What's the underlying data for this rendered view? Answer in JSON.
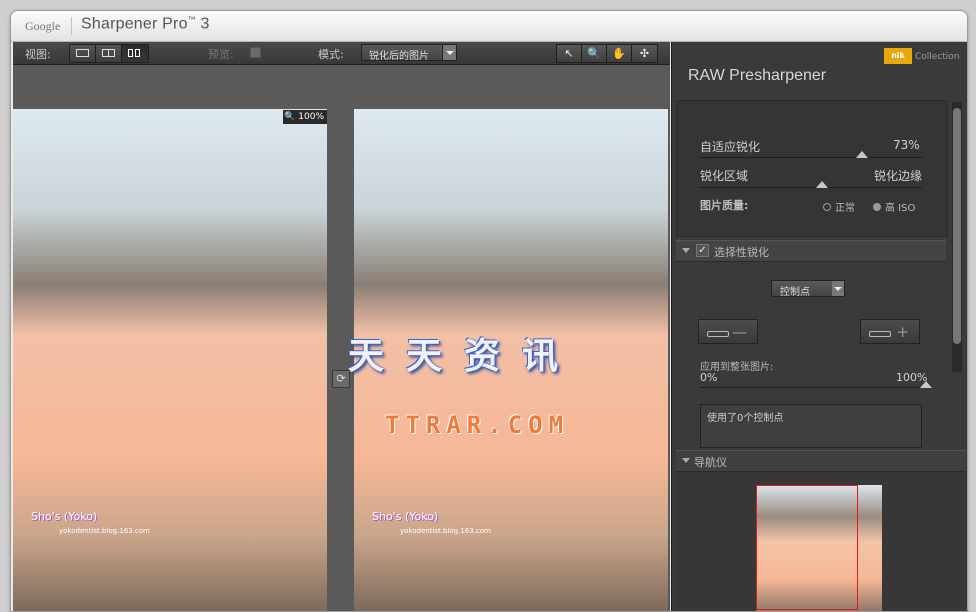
{
  "titlebar": {
    "vendor": "Google",
    "app": "Sharpener Pro",
    "tm": "™",
    "version": "3"
  },
  "toolbar": {
    "view_label": "视图:",
    "preview_label": "预览:",
    "mode_label": "模式:",
    "mode_value": "锐化后的图片",
    "tools": [
      "↖",
      "🔍",
      "✋",
      "✣"
    ]
  },
  "viewport": {
    "zoom": "100%",
    "watermark_cn": "天天资讯",
    "watermark_en": "TTRAR.COM",
    "photo_caption_1": "Sho's (Yoko)",
    "photo_caption_2": "yokodentist.blog.163.com"
  },
  "panel": {
    "logo": "nik",
    "logo_text": "Collection",
    "title": "RAW Presharpener",
    "adaptive_label": "自适应锐化",
    "adaptive_value": "73%",
    "adaptive_fraction": 0.73,
    "sharpen_area_label": "锐化区域",
    "sharpen_edges_label": "锐化边缘",
    "sharpen_fraction": 0.55,
    "quality_label": "图片质量:",
    "quality_normal": "正常",
    "quality_high": "高 ISO",
    "selective_title": "选择性锐化",
    "control_point_label": "控制点",
    "apply_label": "应用到整张图片:",
    "apply_min": "0%",
    "apply_max": "100%",
    "apply_fraction": 1.0,
    "used_points_text": "使用了0个控制点",
    "navigator_title": "导航仪"
  }
}
